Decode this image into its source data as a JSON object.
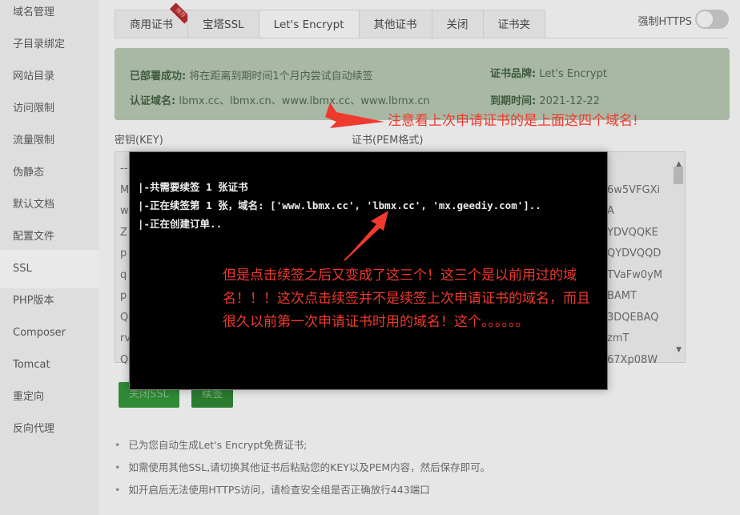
{
  "sidebar": {
    "items": [
      "域名管理",
      "子目录绑定",
      "网站目录",
      "访问限制",
      "流量限制",
      "伪静态",
      "默认文档",
      "配置文件",
      "SSL",
      "PHP版本",
      "Composer",
      "Tomcat",
      "重定向",
      "反向代理"
    ],
    "active": "SSL"
  },
  "tabs": [
    {
      "label": "商用证书",
      "badge": "推荐"
    },
    {
      "label": "宝塔SSL"
    },
    {
      "label": "Let's Encrypt"
    },
    {
      "label": "其他证书"
    },
    {
      "label": "关闭"
    },
    {
      "label": "证书夹"
    }
  ],
  "active_tab": "Let's Encrypt",
  "force_https": {
    "label": "强制HTTPS",
    "on": false
  },
  "info": {
    "status_label": "已部署成功:",
    "status_text": "将在距离到期时间1个月内尝试自动续签",
    "domains_label": "认证域名:",
    "domains": "lbmx.cc、lbmx.cn、www.lbmx.cc、www.lbmx.cn",
    "brand_label": "证书品牌:",
    "brand": "Let's Encrypt",
    "expire_label": "到期时间:",
    "expire": "2021-12-22"
  },
  "key_label": "密钥(KEY)",
  "cert_label": "证书(PEM格式)",
  "key_lines": [
    "--",
    "M",
    "w",
    "Z",
    "p",
    "q",
    "p",
    "Q",
    "rv",
    "Q"
  ],
  "cert_lines": [
    "",
    "6w5VFGXi",
    "A",
    "YDVQQKE",
    "QYDVQQD",
    "TVaFw0yM",
    "BAMT",
    "3DQEBAQ",
    "zmT",
    "67Xp08W"
  ],
  "buttons": {
    "close_ssl": "关闭SSL",
    "renew": "续签"
  },
  "notes": [
    "已为您自动生成Let's Encrypt免费证书;",
    "如需使用其他SSL,请切换其他证书后粘贴您的KEY以及PEM内容，然后保存即可。",
    "如开启后无法使用HTTPS访问，请检查安全组是否正确放行443端口"
  ],
  "modal": {
    "log": [
      "|-共需要续签 1 张证书",
      "|-正在续签第 1 张，域名: ['www.lbmx.cc', 'lbmx.cc', 'mx.geediy.com']..",
      "|-正在创建订单.."
    ]
  },
  "annotations": {
    "top": "注意看上次申请证书的是上面这四个域名!",
    "modal": "但是点击续签之后又变成了这三个！这三个是以前用过的域名！！！这次点击续签并不是续签上次申请证书的域名，而且很久以前第一次申请证书时用的域名！这个。。。。。。",
    "color": "#ef3a2e"
  }
}
